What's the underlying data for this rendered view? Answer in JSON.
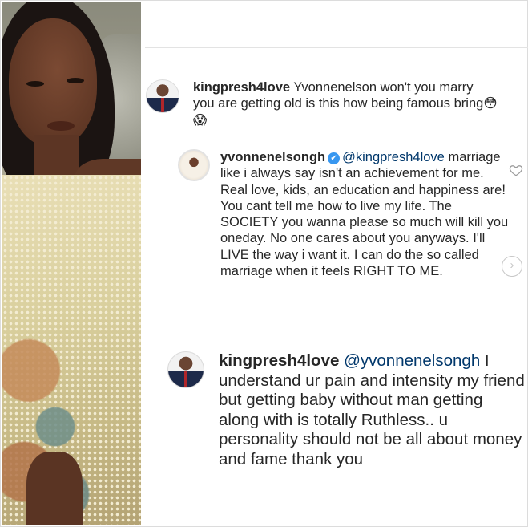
{
  "comments": [
    {
      "username": "kingpresh4love",
      "text": " Yvonnenelson won't you marry you are getting old is this how being famous bring",
      "emoji": "😳😱"
    },
    {
      "username": "yvonnenelsongh",
      "verified": true,
      "mention": "@kingpresh4love",
      "text": " marriage like i always say isn't an achievement for me. Real love, kids, an education and happiness are! You cant tell me how to live my life. The SOCIETY you wanna please so much will kill you oneday. No one cares about you anyways. I'll LIVE the way i want it. I can do the so called marriage when it feels RIGHT TO ME."
    },
    {
      "username": "kingpresh4love",
      "mention": "@yvonnenelsongh",
      "text": " I understand ur pain and intensity my friend but getting baby without man getting along with is totally Ruthless.. u personality should not be all about money and fame thank you"
    }
  ],
  "icons": {
    "verified": "✔",
    "like": "heart-outline-icon",
    "next": "›"
  },
  "colors": {
    "mention": "#00376b",
    "verified": "#3897f0",
    "text": "#262626"
  }
}
